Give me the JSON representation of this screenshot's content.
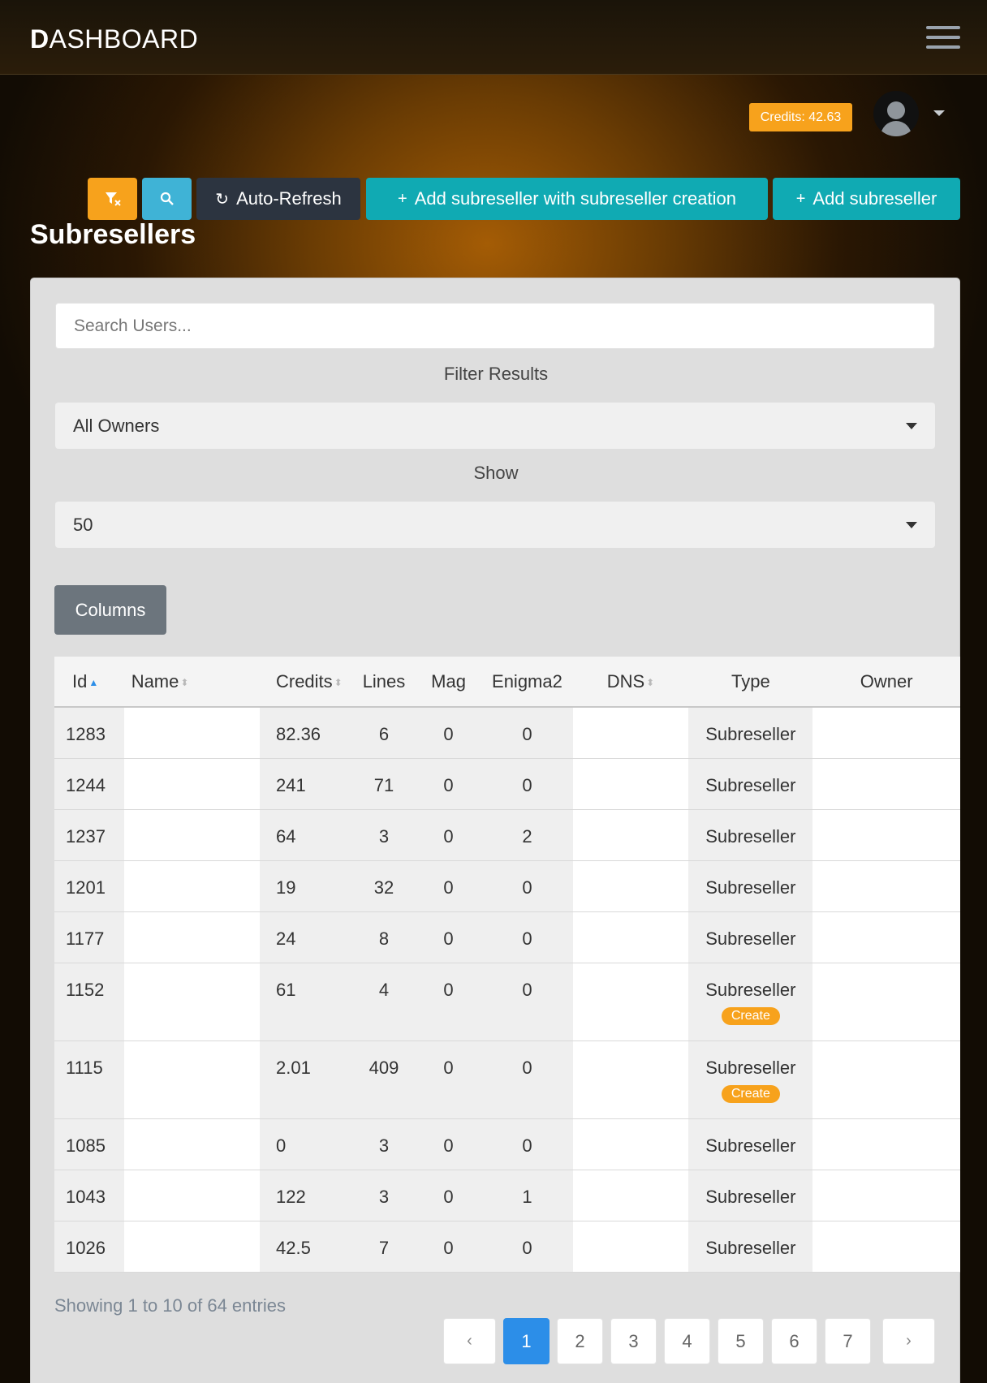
{
  "brand": {
    "first": "D",
    "rest": "ASHBOARD"
  },
  "header": {
    "credits": "Credits: 42.63"
  },
  "toolbar": {
    "auto_refresh": "Auto-Refresh",
    "add_with_creation": "Add subreseller with subreseller creation",
    "add_subreseller": "Add subreseller"
  },
  "page_title": "Subresellers",
  "search": {
    "placeholder": "Search Users..."
  },
  "filters": {
    "filter_label": "Filter Results",
    "owner_value": "All Owners",
    "show_label": "Show",
    "show_value": "50",
    "columns_button": "Columns"
  },
  "table": {
    "headers": {
      "id": "Id",
      "name": "Name",
      "credits": "Credits",
      "lines": "Lines",
      "mag": "Mag",
      "enigma2": "Enigma2",
      "dns": "DNS",
      "type": "Type",
      "owner": "Owner"
    },
    "rows": [
      {
        "id": "1283",
        "credits": "82.36",
        "lines": "6",
        "mag": "0",
        "enigma2": "0",
        "type": "Subreseller",
        "badge": ""
      },
      {
        "id": "1244",
        "credits": "241",
        "lines": "71",
        "mag": "0",
        "enigma2": "0",
        "type": "Subreseller",
        "badge": ""
      },
      {
        "id": "1237",
        "credits": "64",
        "lines": "3",
        "mag": "0",
        "enigma2": "2",
        "type": "Subreseller",
        "badge": ""
      },
      {
        "id": "1201",
        "credits": "19",
        "lines": "32",
        "mag": "0",
        "enigma2": "0",
        "type": "Subreseller",
        "badge": ""
      },
      {
        "id": "1177",
        "credits": "24",
        "lines": "8",
        "mag": "0",
        "enigma2": "0",
        "type": "Subreseller",
        "badge": ""
      },
      {
        "id": "1152",
        "credits": "61",
        "lines": "4",
        "mag": "0",
        "enigma2": "0",
        "type": "Subreseller",
        "badge": "Create"
      },
      {
        "id": "1115",
        "credits": "2.01",
        "lines": "409",
        "mag": "0",
        "enigma2": "0",
        "type": "Subreseller",
        "badge": "Create"
      },
      {
        "id": "1085",
        "credits": "0",
        "lines": "3",
        "mag": "0",
        "enigma2": "0",
        "type": "Subreseller",
        "badge": ""
      },
      {
        "id": "1043",
        "credits": "122",
        "lines": "3",
        "mag": "0",
        "enigma2": "1",
        "type": "Subreseller",
        "badge": ""
      },
      {
        "id": "1026",
        "credits": "42.5",
        "lines": "7",
        "mag": "0",
        "enigma2": "0",
        "type": "Subreseller",
        "badge": ""
      }
    ]
  },
  "footer": {
    "showing": "Showing 1 to 10 of 64 entries",
    "prev": "‹",
    "next": "›",
    "pages": [
      "1",
      "2",
      "3",
      "4",
      "5",
      "6",
      "7"
    ],
    "active_page": "1"
  }
}
